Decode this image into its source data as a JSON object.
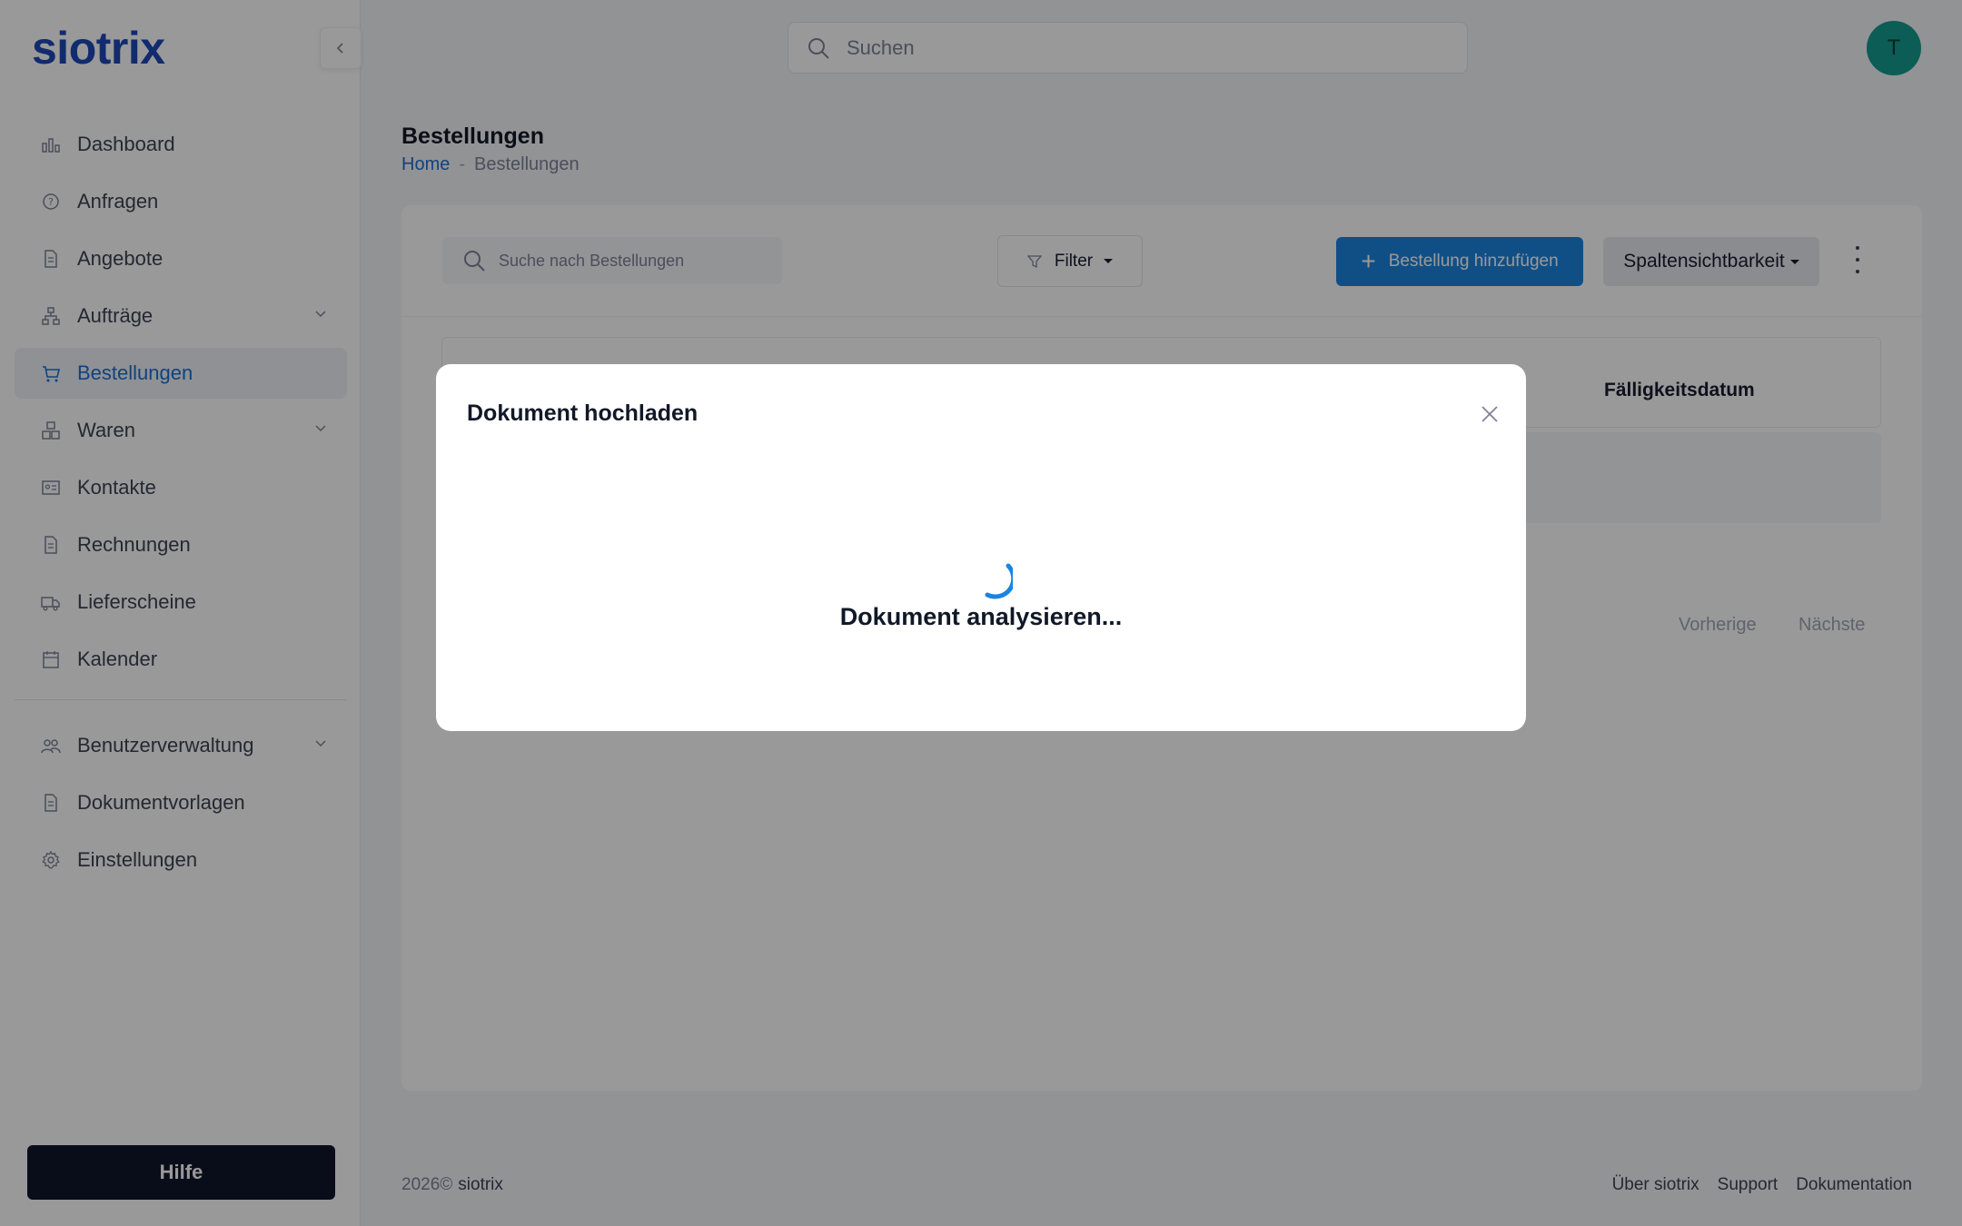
{
  "app": {
    "logo": "siotrix"
  },
  "colors": {
    "accent": "#1b84e0",
    "brand": "#1d49b8",
    "avatar": "#139c8f"
  },
  "header": {
    "search_placeholder": "Suchen",
    "avatar_initial": "T"
  },
  "sidebar": {
    "items": [
      {
        "label": "Dashboard",
        "icon": "bar-chart-icon"
      },
      {
        "label": "Anfragen",
        "icon": "question-circle-icon"
      },
      {
        "label": "Angebote",
        "icon": "document-icon"
      },
      {
        "label": "Aufträge",
        "icon": "hierarchy-icon",
        "expandable": true
      },
      {
        "label": "Bestellungen",
        "icon": "cart-icon",
        "active": true
      },
      {
        "label": "Waren",
        "icon": "boxes-icon",
        "expandable": true
      },
      {
        "label": "Kontakte",
        "icon": "id-card-icon"
      },
      {
        "label": "Rechnungen",
        "icon": "document-icon"
      },
      {
        "label": "Lieferscheine",
        "icon": "truck-icon"
      },
      {
        "label": "Kalender",
        "icon": "calendar-icon"
      }
    ],
    "secondary": [
      {
        "label": "Benutzerverwaltung",
        "icon": "users-icon",
        "expandable": true
      },
      {
        "label": "Dokumentvorlagen",
        "icon": "document-icon"
      },
      {
        "label": "Einstellungen",
        "icon": "gear-icon"
      }
    ],
    "help_label": "Hilfe"
  },
  "page": {
    "title": "Bestellungen",
    "breadcrumb": {
      "home": "Home",
      "separator": "-",
      "current": "Bestellungen"
    }
  },
  "toolbar": {
    "search_placeholder": "Suche nach Bestellungen",
    "filter_label": "Filter",
    "add_label": "Bestellung hinzufügen",
    "columns_label": "Spaltensichtbarkeit"
  },
  "table": {
    "visible_header": "Fälligkeitsdatum"
  },
  "pagination": {
    "prev": "Vorherige",
    "next": "Nächste"
  },
  "footer": {
    "year": "2026©",
    "brand": "siotrix",
    "links": [
      "Über siotrix",
      "Support",
      "Dokumentation"
    ]
  },
  "modal": {
    "title": "Dokument hochladen",
    "status": "Dokument analysieren..."
  }
}
